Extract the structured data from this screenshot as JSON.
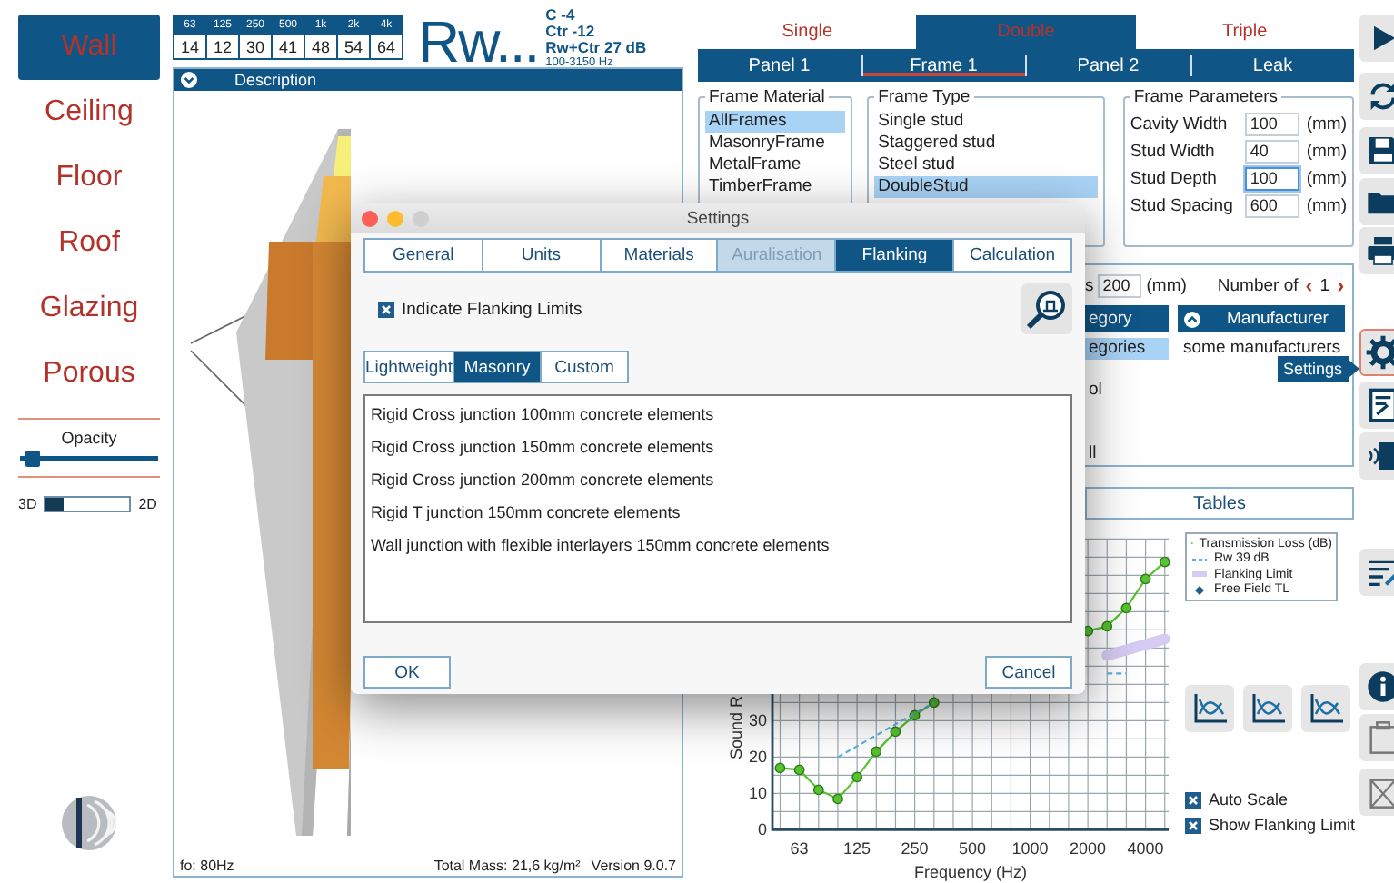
{
  "nav": {
    "items": [
      {
        "label": "Wall",
        "selected": true
      },
      {
        "label": "Ceiling",
        "selected": false
      },
      {
        "label": "Floor",
        "selected": false
      },
      {
        "label": "Roof",
        "selected": false
      },
      {
        "label": "Glazing",
        "selected": false
      },
      {
        "label": "Porous",
        "selected": false
      }
    ],
    "opacity": {
      "label": "Opacity",
      "level": 0.05
    },
    "view_switch": {
      "left": "3D",
      "right": "2D",
      "is_3d": true
    }
  },
  "spectrum": {
    "bands": [
      {
        "frequency": "63",
        "value": "14"
      },
      {
        "frequency": "125",
        "value": "12"
      },
      {
        "frequency": "250",
        "value": "30"
      },
      {
        "frequency": "500",
        "value": "41"
      },
      {
        "frequency": "1k",
        "value": "48"
      },
      {
        "frequency": "2k",
        "value": "54"
      },
      {
        "frequency": "4k",
        "value": "64"
      }
    ]
  },
  "rating": {
    "title": "Rw...",
    "c": "C -4",
    "ctr": "Ctr -12",
    "rw_ctr": "Rw+Ctr 27 dB",
    "range": "100-3150 Hz"
  },
  "description": {
    "title": "Description",
    "resonance": "fo: 80Hz",
    "total_mass": "Total Mass:  21,6 kg/m²",
    "version": "Version 9.0.7"
  },
  "construction_tabs": [
    {
      "label": "Single",
      "selected": false
    },
    {
      "label": "Double",
      "selected": true
    },
    {
      "label": "Triple",
      "selected": false
    }
  ],
  "sub_tabs": [
    {
      "label": "Panel 1",
      "selected": false
    },
    {
      "label": "Frame 1",
      "selected": true
    },
    {
      "label": "Panel 2",
      "selected": false
    },
    {
      "label": "Leak",
      "selected": false
    }
  ],
  "frame_material": {
    "title": "Frame Material",
    "items": [
      {
        "label": "AllFrames",
        "selected": true
      },
      {
        "label": "MasonryFrame",
        "selected": false
      },
      {
        "label": "MetalFrame",
        "selected": false
      },
      {
        "label": "TimberFrame",
        "selected": false
      }
    ]
  },
  "frame_type": {
    "title": "Frame Type",
    "items": [
      {
        "label": "Single stud",
        "selected": false
      },
      {
        "label": "Staggered stud",
        "selected": false
      },
      {
        "label": "Steel stud",
        "selected": false
      },
      {
        "label": "DoubleStud",
        "selected": true
      }
    ]
  },
  "frame_parameters": {
    "title": "Frame Parameters",
    "fields": [
      {
        "label": "Cavity Width",
        "value": "100",
        "unit": "(mm)",
        "focused": false
      },
      {
        "label": "Stud Width",
        "value": "40",
        "unit": "(mm)",
        "focused": false
      },
      {
        "label": "Stud Depth",
        "value": "100",
        "unit": "(mm)",
        "focused": true
      },
      {
        "label": "Stud Spacing",
        "value": "600",
        "unit": "(mm)",
        "focused": false
      }
    ]
  },
  "layer_panel": {
    "thickness_label": "s",
    "thickness": "200",
    "unit": "(mm)",
    "count_label": "Number of",
    "prev": "‹",
    "count": "1",
    "next": "›",
    "columns": [
      "egory",
      "Manufacturer"
    ],
    "categories": [
      {
        "label": "egories",
        "selected": true
      },
      {
        "label": "ol",
        "selected": false
      },
      {
        "label": "ll",
        "selected": false
      }
    ],
    "manufacturers": [
      {
        "label": "some manufacturers",
        "selected": false
      }
    ]
  },
  "tables_button": "Tables",
  "chart": {
    "chart_data": {
      "type": "line",
      "xlabel": "Frequency (Hz)",
      "ylabel": "Sound R",
      "categories": [
        null,
        "63",
        null,
        null,
        "125",
        null,
        null,
        "250",
        null,
        null,
        "500",
        null,
        null,
        "1000",
        null,
        null,
        "2000",
        null,
        null,
        "4000",
        null
      ],
      "grid": true,
      "yticks": [
        0,
        10,
        20,
        30
      ],
      "ylim": [
        0,
        80
      ],
      "series": [
        {
          "name": "Transmission Loss (dB)",
          "color": "#55c22e",
          "marker": "circle",
          "values": [
            17,
            16.5,
            11,
            8.5,
            14.5,
            21.5,
            27,
            31.5,
            35,
            null,
            null,
            null,
            null,
            null,
            null,
            null,
            54.7,
            56,
            61,
            69,
            73.7
          ]
        },
        {
          "name": "Rw 39 dB",
          "color": "#5ab4e0",
          "line_style": "dashed",
          "values": [
            null,
            null,
            null,
            20,
            23,
            26,
            29,
            32,
            35,
            null,
            null,
            null,
            null,
            null,
            null,
            null,
            null,
            43,
            43,
            null,
            null
          ]
        },
        {
          "name": "Flanking Limit",
          "color": "#d6cbf3",
          "values": [
            null,
            null,
            null,
            null,
            null,
            null,
            null,
            null,
            null,
            null,
            null,
            null,
            null,
            null,
            null,
            null,
            null,
            48,
            49.5,
            51,
            52.5
          ]
        },
        {
          "name": "Free Field TL",
          "color": "#1f5e8c",
          "values": [
            null,
            null,
            null,
            null,
            null,
            null,
            null,
            null,
            null,
            null,
            null,
            null,
            null,
            null,
            null,
            null,
            null,
            null,
            null,
            null,
            null
          ]
        }
      ]
    }
  },
  "chart_options": [
    {
      "label": "Auto Scale",
      "checked": true
    },
    {
      "label": "Show Flanking Limit",
      "checked": true
    }
  ],
  "toolbar": [
    {
      "kind": "play",
      "highlighted": false
    },
    {
      "kind": "refresh",
      "highlighted": false
    },
    {
      "kind": "save",
      "highlighted": false
    },
    {
      "kind": "folder",
      "highlighted": false
    },
    {
      "kind": "print",
      "highlighted": false
    },
    {
      "kind": "settings",
      "highlighted": true
    },
    {
      "kind": "report",
      "highlighted": false
    },
    {
      "kind": "speaker",
      "highlighted": false
    },
    {
      "kind": "list",
      "highlighted": false
    },
    {
      "kind": "info",
      "highlighted": false
    },
    {
      "kind": "clipboard",
      "highlighted": false
    },
    {
      "kind": "delete",
      "highlighted": false
    }
  ],
  "tooltip": "Settings",
  "settings_dialog": {
    "title": "Settings",
    "tabs": [
      {
        "label": "General",
        "selected": false,
        "disabled": false
      },
      {
        "label": "Units",
        "selected": false,
        "disabled": false
      },
      {
        "label": "Materials",
        "selected": false,
        "disabled": false
      },
      {
        "label": "Auralisation",
        "selected": false,
        "disabled": true
      },
      {
        "label": "Flanking",
        "selected": true,
        "disabled": false
      },
      {
        "label": "Calculation",
        "selected": false,
        "disabled": false
      }
    ],
    "indicate_flanking": {
      "label": "Indicate Flanking Limits",
      "checked": true
    },
    "junction_types": [
      {
        "label": "Lightweight",
        "selected": false
      },
      {
        "label": "Masonry",
        "selected": true
      },
      {
        "label": "Custom",
        "selected": false
      }
    ],
    "junctions": [
      "Rigid Cross junction 100mm concrete elements",
      "Rigid Cross junction 150mm concrete elements",
      "Rigid Cross junction 200mm concrete elements",
      "Rigid T junction 150mm concrete elements",
      "Wall junction with flexible interlayers 150mm concrete elements"
    ],
    "buttons": [
      "OK",
      "Cancel"
    ]
  }
}
